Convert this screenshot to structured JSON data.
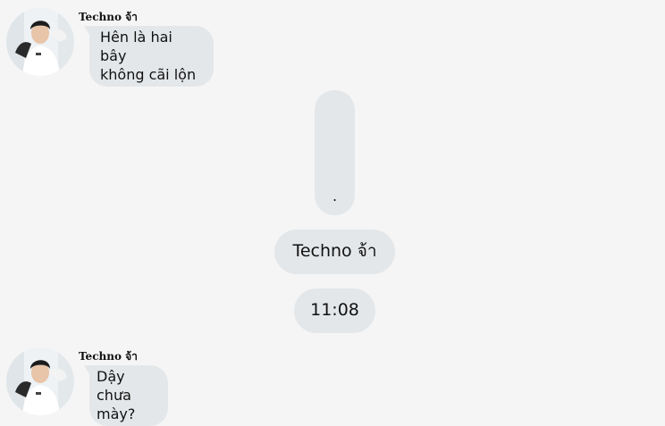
{
  "messages": [
    {
      "sender": "Techno จ้า",
      "text_lines": [
        "Hên là hai bây",
        "không cãi lộn"
      ]
    },
    {
      "sender": "Techno จ้า",
      "text_lines": [
        "Dậy chưa",
        "mày?"
      ]
    }
  ],
  "center": {
    "tall_pill_text": ".",
    "name_pill_text": "Techno จ้า",
    "time_pill_text": "11:08"
  },
  "icons": {
    "avatar": "user-avatar-photo"
  }
}
